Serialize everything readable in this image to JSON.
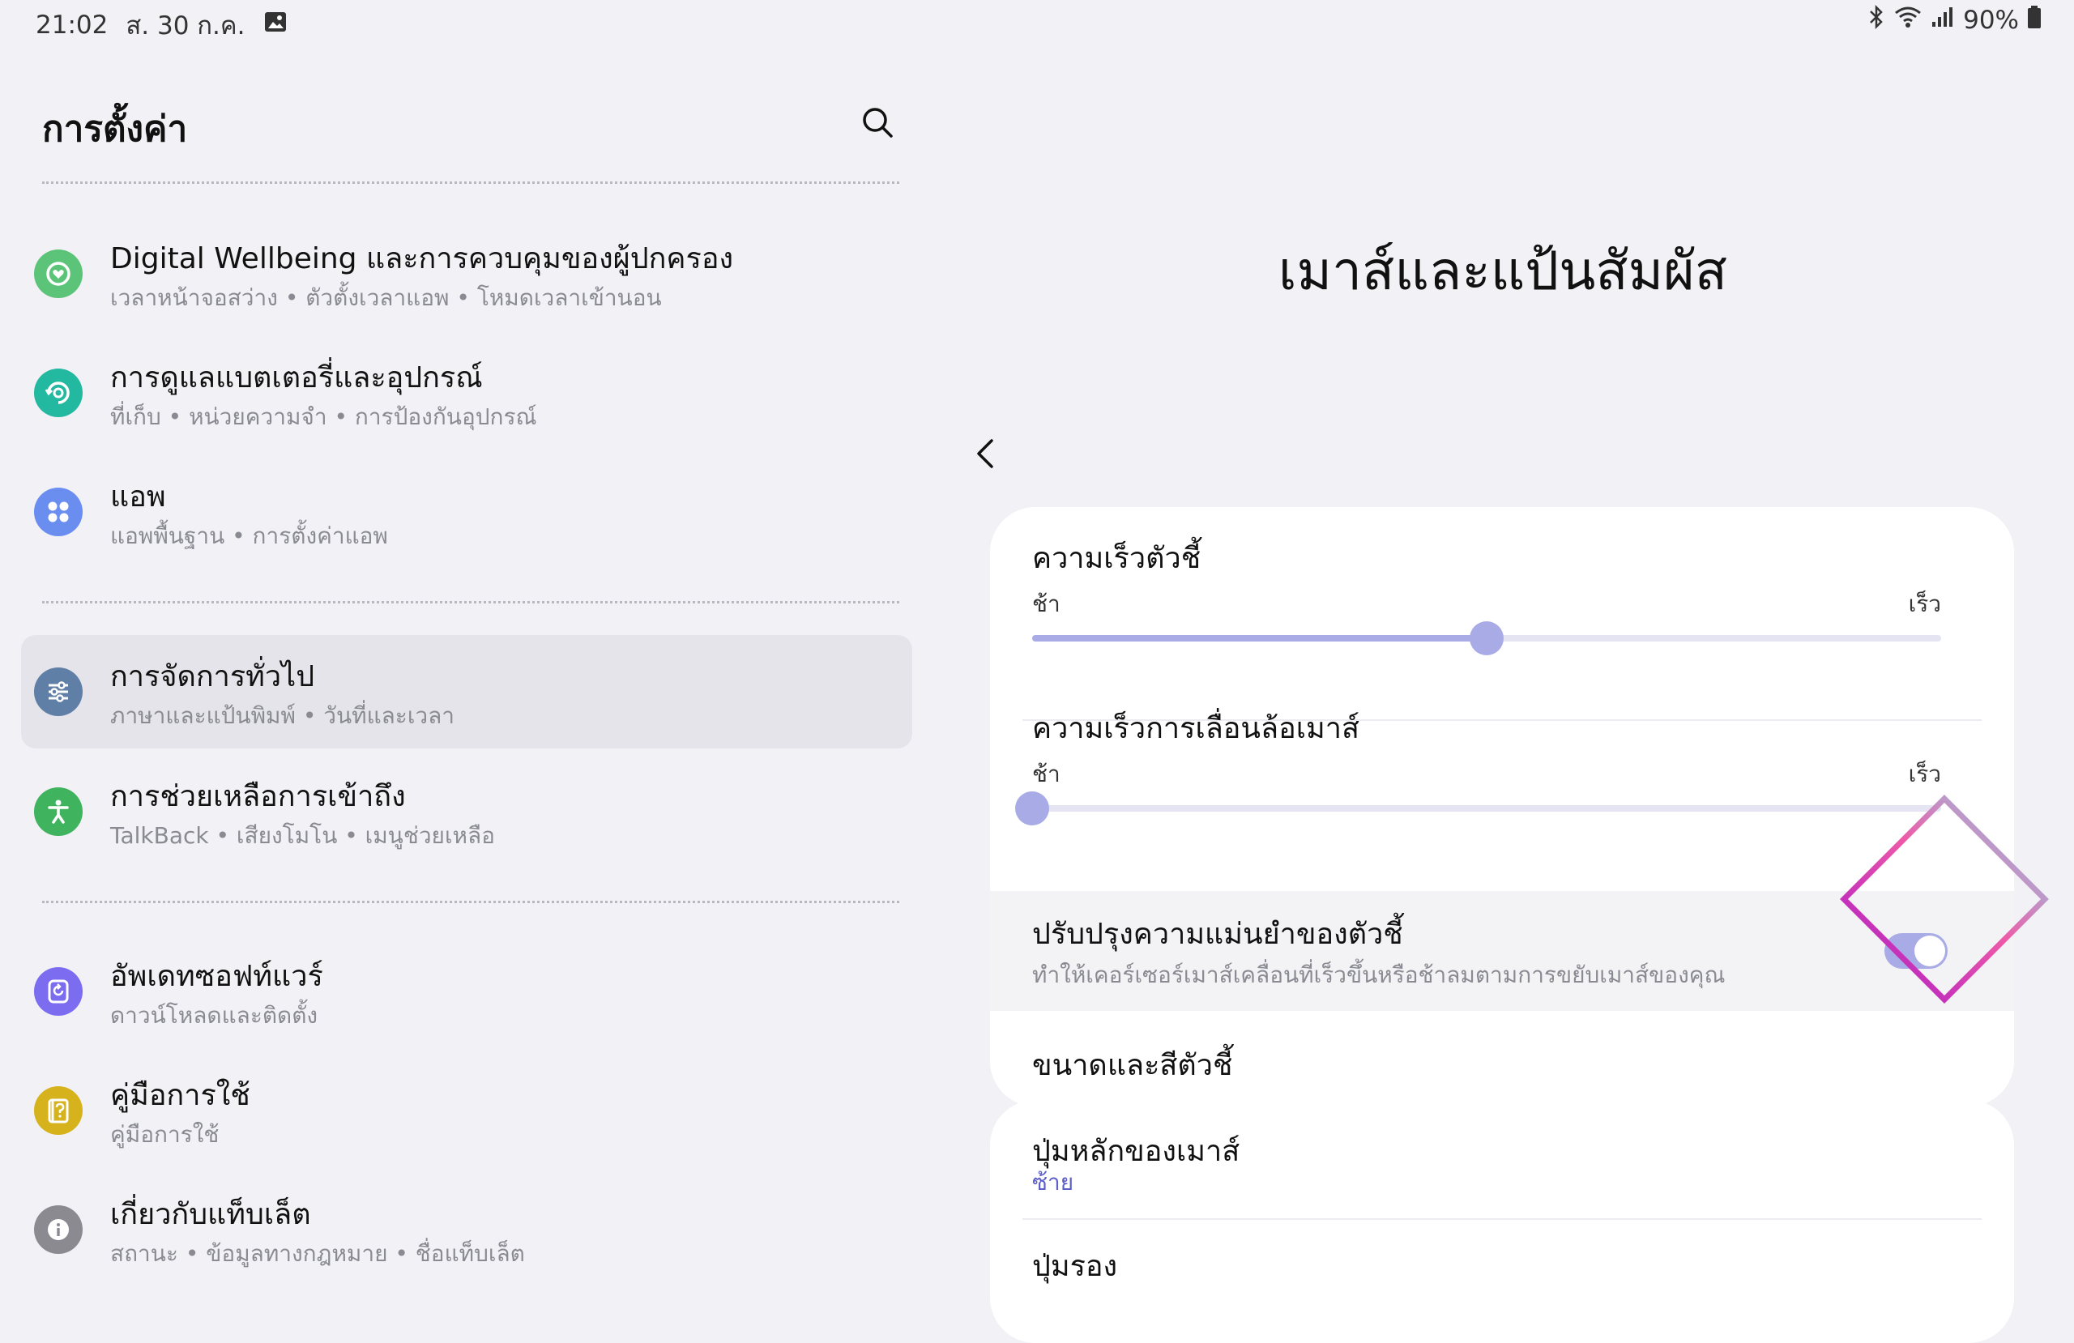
{
  "status_bar": {
    "time": "21:02",
    "date": "ส. 30 ก.ค.",
    "battery": "90%",
    "icons": [
      "image-icon",
      "bluetooth-icon",
      "wifi-icon",
      "signal-icon",
      "battery-icon"
    ]
  },
  "left_pane": {
    "title": "การตั้งค่า",
    "items": [
      {
        "title": "Digital Wellbeing และการควบคุมของผู้ปกครอง",
        "subtitle": "เวลาหน้าจอสว่าง • ตัวตั้งเวลาแอพ • โหมดเวลาเข้านอน",
        "icon": "digital-wellbeing-icon",
        "color": "#5cc479"
      },
      {
        "title": "การดูแลแบตเตอรี่และอุปกรณ์",
        "subtitle": "ที่เก็บ • หน่วยความจำ • การป้องกันอุปกรณ์",
        "icon": "device-care-icon",
        "color": "#23b8a0"
      },
      {
        "title": "แอพ",
        "subtitle": "แอพพื้นฐาน • การตั้งค่าแอพ",
        "icon": "apps-icon",
        "color": "#6a8df0"
      },
      {
        "title": "การจัดการทั่วไป",
        "subtitle": "ภาษาและแป้นพิมพ์ • วันที่และเวลา",
        "icon": "general-management-icon",
        "color": "#5f7fa6",
        "selected": true
      },
      {
        "title": "การช่วยเหลือการเข้าถึง",
        "subtitle": "TalkBack • เสียงโมโน • เมนูช่วยเหลือ",
        "icon": "accessibility-icon",
        "color": "#3fb35e"
      },
      {
        "title": "อัพเดทซอฟท์แวร์",
        "subtitle": "ดาวน์โหลดและติดตั้ง",
        "icon": "software-update-icon",
        "color": "#7b6cf0"
      },
      {
        "title": "คู่มือการใช้",
        "subtitle": "คู่มือการใช้",
        "icon": "user-manual-icon",
        "color": "#d6b21c"
      },
      {
        "title": "เกี่ยวกับแท็บเล็ต",
        "subtitle": "สถานะ • ข้อมูลทางกฎหมาย • ชื่อแท็บเล็ต",
        "icon": "about-tablet-icon",
        "color": "#8a8a90"
      }
    ]
  },
  "right_pane": {
    "title": "เมาส์และแป้นสัมผัส",
    "pointer_speed": {
      "label": "ความเร็วตัวชี้",
      "min_label": "ช้า",
      "max_label": "เร็ว",
      "value": 0.5
    },
    "scroll_speed": {
      "label": "ความเร็วการเลื่อนล้อเมาส์",
      "min_label": "ช้า",
      "max_label": "เร็ว",
      "value": 0.0
    },
    "pointer_precision": {
      "label": "ปรับปรุงความแม่นยำของตัวชี้",
      "description": "ทำให้เคอร์เซอร์เมาส์เคลื่อนที่เร็วขึ้นหรือช้าลมตามการขยับเมาส์ของคุณ",
      "enabled": true
    },
    "pointer_size_color": {
      "label": "ขนาดและสีตัวชี้"
    },
    "primary_button": {
      "label": "ปุ่มหลักของเมาส์",
      "value": "ซ้าย"
    },
    "secondary_button": {
      "label": "ปุ่มรอง"
    },
    "accent_color": "#a9abe6"
  }
}
